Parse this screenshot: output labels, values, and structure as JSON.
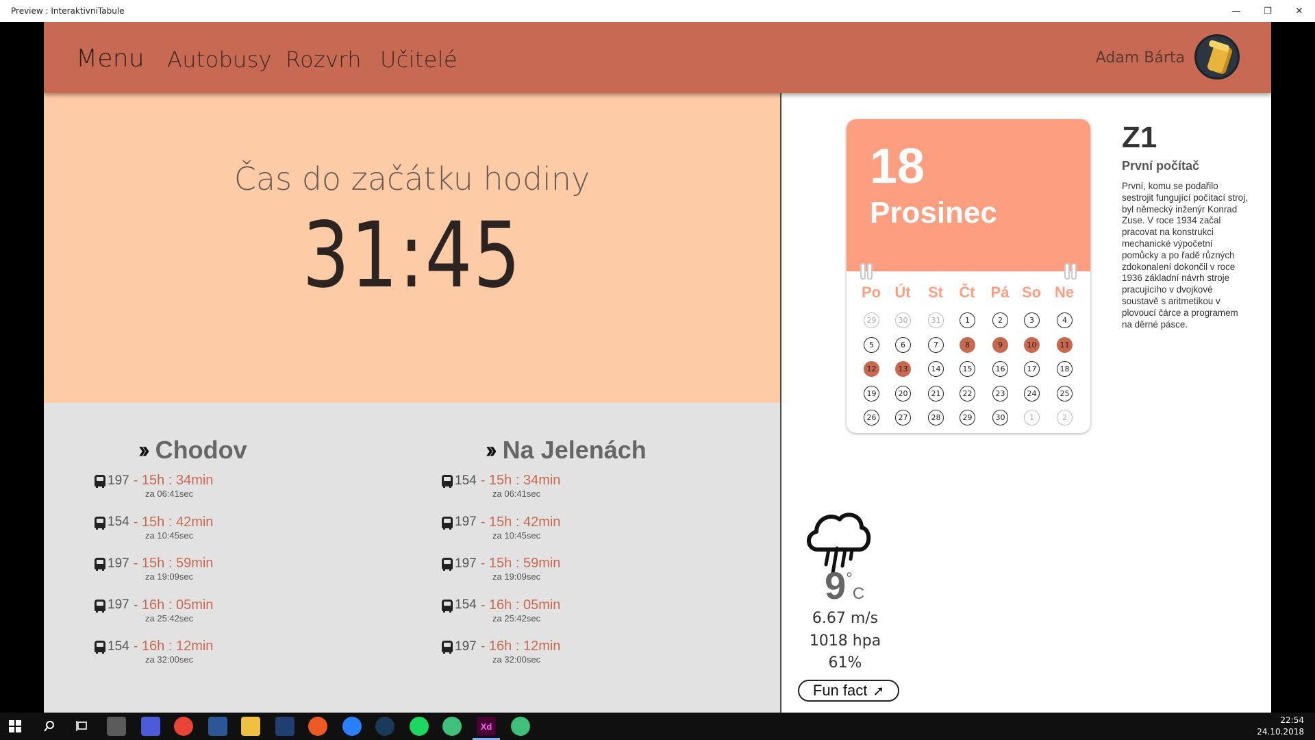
{
  "window": {
    "title": "Preview : InteraktivniTabule"
  },
  "nav": {
    "items": [
      "Menu",
      "Autobusy",
      "Rozvrh",
      "Učitelé"
    ],
    "user": "Adam Bárta"
  },
  "countdown": {
    "label": "Čas do začátku hodiny",
    "time": "31:45"
  },
  "stops": [
    {
      "name": "Chodov",
      "departures": [
        {
          "line": "197",
          "time": "- 15h : 34min",
          "in": "za 06:41sec"
        },
        {
          "line": "154",
          "time": "- 15h : 42min",
          "in": "za 10:45sec"
        },
        {
          "line": "197",
          "time": "- 15h : 59min",
          "in": "za 19:09sec"
        },
        {
          "line": "197",
          "time": "- 16h : 05min",
          "in": "za 25:42sec"
        },
        {
          "line": "154",
          "time": "- 16h : 12min",
          "in": "za 32:00sec"
        }
      ]
    },
    {
      "name": "Na Jelenách",
      "departures": [
        {
          "line": "154",
          "time": "- 15h : 34min",
          "in": "za 06:41sec"
        },
        {
          "line": "197",
          "time": "- 15h : 42min",
          "in": "za 10:45sec"
        },
        {
          "line": "197",
          "time": "- 15h : 59min",
          "in": "za 19:09sec"
        },
        {
          "line": "154",
          "time": "- 16h : 05min",
          "in": "za 25:42sec"
        },
        {
          "line": "197",
          "time": "- 16h : 12min",
          "in": "za 32:00sec"
        }
      ]
    }
  ],
  "calendar": {
    "day": "18",
    "month": "Prosinec",
    "weekdays": [
      "Po",
      "Út",
      "St",
      "Čt",
      "Pá",
      "So",
      "Ne"
    ],
    "weeks": [
      [
        {
          "d": "29",
          "s": "muted"
        },
        {
          "d": "30",
          "s": "muted"
        },
        {
          "d": "31",
          "s": "muted"
        },
        {
          "d": "1"
        },
        {
          "d": "2"
        },
        {
          "d": "3"
        },
        {
          "d": "4"
        }
      ],
      [
        {
          "d": "5"
        },
        {
          "d": "6"
        },
        {
          "d": "7"
        },
        {
          "d": "8",
          "s": "hl"
        },
        {
          "d": "9",
          "s": "hl"
        },
        {
          "d": "10",
          "s": "hl"
        },
        {
          "d": "11",
          "s": "hl"
        }
      ],
      [
        {
          "d": "12",
          "s": "hl"
        },
        {
          "d": "13",
          "s": "hl"
        },
        {
          "d": "14"
        },
        {
          "d": "15"
        },
        {
          "d": "16"
        },
        {
          "d": "17"
        },
        {
          "d": "18"
        }
      ],
      [
        {
          "d": "19"
        },
        {
          "d": "20"
        },
        {
          "d": "21"
        },
        {
          "d": "22"
        },
        {
          "d": "23"
        },
        {
          "d": "24"
        },
        {
          "d": "25"
        }
      ],
      [
        {
          "d": "26"
        },
        {
          "d": "27"
        },
        {
          "d": "28"
        },
        {
          "d": "29"
        },
        {
          "d": "30"
        },
        {
          "d": "1",
          "s": "muted"
        },
        {
          "d": "2",
          "s": "muted"
        }
      ]
    ]
  },
  "fact": {
    "code": "Z1",
    "title": "První počítač",
    "text": "První, komu se podařilo sestrojit fungující počítací stroj, byl německý inženýr Konrad Zuse. V roce 1934 začal pracovat na konstrukci mechanické výpočetní pomůcky a po řadě různých zdokonalení dokončil v roce 1936 základní návrh stroje pracujícího v dvojkové soustavě s aritmetikou v plovoucí čárce a programem na děrné pásce."
  },
  "weather": {
    "icon": "rain-cloud-icon",
    "temp": "9",
    "deg": "°",
    "unit": "C",
    "wind": "6.67 m/s",
    "pressure": "1018 hpa",
    "humidity": "61%",
    "button": "Fun fact"
  },
  "taskbar": {
    "time": "22:54",
    "date": "24.10.2018"
  },
  "colors": {
    "nav": "#c86a53",
    "countdown_bg": "#fecba7",
    "accent": "#fe9e80",
    "bus_time": "#c8694f"
  }
}
